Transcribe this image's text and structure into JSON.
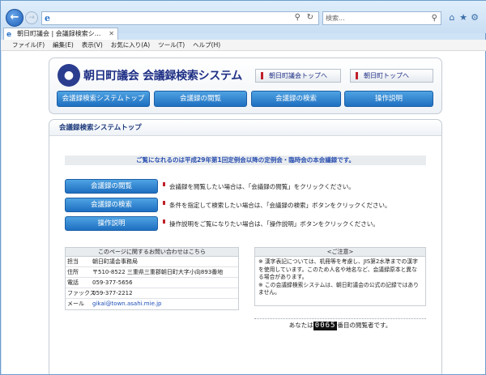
{
  "browser": {
    "search_placeholder": "検索...",
    "tab_title": "朝日町議会 | 会議録検索シ...",
    "menu": [
      "ファイル(F)",
      "編集(E)",
      "表示(V)",
      "お気に入り(A)",
      "ツール(T)",
      "ヘルプ(H)"
    ]
  },
  "header": {
    "site_title": "朝日町議会 会議録検索システム",
    "link_council": "朝日町議会トップへ",
    "link_town": "朝日町トップへ",
    "nav": [
      "会議録検索システムトップ",
      "会議録の閲覧",
      "会議録の検索",
      "操作説明"
    ]
  },
  "main": {
    "heading": "会議録検索システムトップ",
    "notice": "ご覧になれるのは平成29年第1回定例会以降の定例会・臨時会の本会議録です。",
    "actions": [
      {
        "label": "会議録の閲覧",
        "desc": "会議録を閲覧したい場合は、「会議録の閲覧」をクリックください。"
      },
      {
        "label": "会議録の検索",
        "desc": "条件を指定して検索したい場合は、「会議録の検索」ボタンをクリックください。"
      },
      {
        "label": "操作説明",
        "desc": "操作説明をご覧になりたい場合は、「操作説明」ボタンをクリックください。"
      }
    ],
    "contact": {
      "heading": "このページに関するお問い合わせはこちら",
      "rows": [
        {
          "label": "担当",
          "value": "朝日町議会事務局"
        },
        {
          "label": "住所",
          "value": "〒510-8522 三重県三重郡朝日町大字小向893番地"
        },
        {
          "label": "電話",
          "value": "059-377-5656"
        },
        {
          "label": "ファックス",
          "value": "059-377-2212"
        },
        {
          "label": "メール",
          "value": "gikai@town.asahi.mie.jp"
        }
      ]
    },
    "caution": {
      "heading": "<ご注意>",
      "lines": [
        "※ 漢字表記については、机冊等を考慮し、JIS第2水準までの漢字を使用しています。このため人名や地名など、会議録原本と異なる場合があります。",
        "※ この会議録検索システムは、朝日町議会の公式の記録ではありません。"
      ]
    },
    "visitor": {
      "prefix": "あなたは",
      "count": "0065",
      "suffix": "番目の閲覧者です。"
    }
  }
}
